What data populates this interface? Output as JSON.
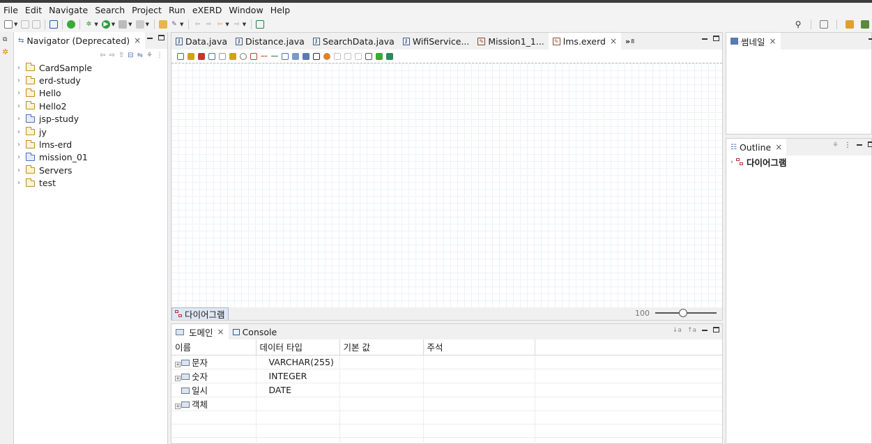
{
  "menu": [
    "File",
    "Edit",
    "Navigate",
    "Search",
    "Project",
    "Run",
    "eXERD",
    "Window",
    "Help"
  ],
  "navigator": {
    "tab_label": "Navigator (Deprecated)",
    "projects": [
      {
        "name": "CardSample",
        "kind": "folder"
      },
      {
        "name": "erd-study",
        "kind": "folder"
      },
      {
        "name": "Hello",
        "kind": "folder"
      },
      {
        "name": "Hello2",
        "kind": "folder"
      },
      {
        "name": "jsp-study",
        "kind": "web"
      },
      {
        "name": "jy",
        "kind": "folder"
      },
      {
        "name": "lms-erd",
        "kind": "folder"
      },
      {
        "name": "mission_01",
        "kind": "web"
      },
      {
        "name": "Servers",
        "kind": "folder"
      },
      {
        "name": "test",
        "kind": "folder"
      }
    ]
  },
  "editor": {
    "tabs": [
      {
        "label": "Data.java",
        "icon": "java-file-icon"
      },
      {
        "label": "Distance.java",
        "icon": "java-file-icon"
      },
      {
        "label": "SearchData.java",
        "icon": "java-file-icon"
      },
      {
        "label": "WifiService...",
        "icon": "java-file-icon"
      },
      {
        "label": "Mission1_1...",
        "icon": "erd-file-icon"
      },
      {
        "label": "lms.exerd",
        "icon": "erd-file-icon",
        "active": true
      }
    ],
    "overflow_count": "8",
    "diagram_tab": "다이어그램",
    "zoom_value": "100",
    "zoom_level": 0.45
  },
  "domain": {
    "tab_label": "도메인",
    "console_label": "Console",
    "columns": [
      "이름",
      "데이터 타입",
      "기본 값",
      "주석"
    ],
    "rows": [
      {
        "name": "문자",
        "type": "VARCHAR(255)",
        "expandable": true
      },
      {
        "name": "숫자",
        "type": "INTEGER",
        "expandable": true
      },
      {
        "name": "일시",
        "type": "DATE",
        "expandable": false
      },
      {
        "name": "객체",
        "type": "",
        "expandable": true
      }
    ]
  },
  "thumbnail": {
    "tab_label": "썸네일"
  },
  "outline": {
    "tab_label": "Outline",
    "item": "다이어그램"
  }
}
